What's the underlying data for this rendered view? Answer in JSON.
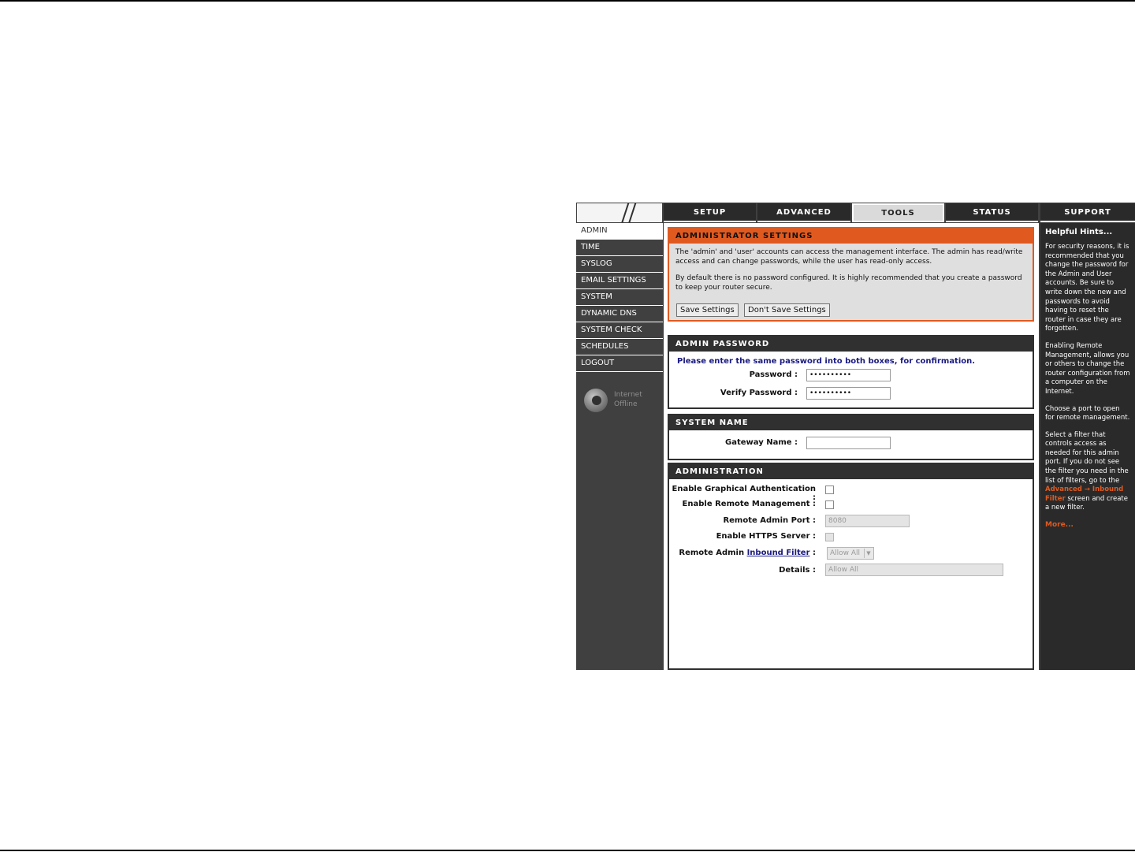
{
  "nav": {
    "tabs": [
      {
        "label": "SETUP"
      },
      {
        "label": "ADVANCED"
      },
      {
        "label": "TOOLS"
      },
      {
        "label": "STATUS"
      },
      {
        "label": "SUPPORT"
      }
    ]
  },
  "sidebar": {
    "items": [
      {
        "label": "ADMIN"
      },
      {
        "label": "TIME"
      },
      {
        "label": "SYSLOG"
      },
      {
        "label": "EMAIL SETTINGS"
      },
      {
        "label": "SYSTEM"
      },
      {
        "label": "DYNAMIC DNS"
      },
      {
        "label": "SYSTEM CHECK"
      },
      {
        "label": "SCHEDULES"
      },
      {
        "label": "LOGOUT"
      }
    ],
    "internet_status": {
      "line1": "Internet",
      "line2": "Offline"
    }
  },
  "admin_settings": {
    "title": "ADMINISTRATOR SETTINGS",
    "desc1": "The 'admin' and 'user' accounts can access the management interface. The admin has read/write access and can change passwords, while the user has read-only access.",
    "desc2": "By default there is no password configured. It is highly recommended that you create a password to keep your router secure.",
    "save_label": "Save Settings",
    "dont_save_label": "Don't Save Settings"
  },
  "admin_password": {
    "title": "ADMIN PASSWORD",
    "instruction": "Please enter the same password into both boxes, for confirmation.",
    "password_label": "Password :",
    "password_value": "••••••••••",
    "verify_label": "Verify Password :",
    "verify_value": "••••••••••"
  },
  "system_name": {
    "title": "SYSTEM NAME",
    "gateway_label": "Gateway Name :",
    "gateway_value": ""
  },
  "administration": {
    "title": "ADMINISTRATION",
    "graphical_auth_label": "Enable Graphical Authentication :",
    "remote_mgmt_label": "Enable Remote Management :",
    "remote_port_label": "Remote Admin Port :",
    "remote_port_value": "8080",
    "https_label": "Enable HTTPS Server :",
    "inbound_prefix": "Remote Admin ",
    "inbound_link": "Inbound Filter",
    "inbound_suffix": " :",
    "inbound_value": "Allow All",
    "details_label": "Details :",
    "details_value": "Allow All"
  },
  "help": {
    "title": "Helpful Hints...",
    "hint1": "For security reasons, it is recommended that you change the password for the Admin and User accounts. Be sure to write down the new and passwords to avoid having to reset the router in case they are forgotten.",
    "hint2": "Enabling Remote Management, allows you or others to change the router configuration from a computer on the Internet.",
    "hint3": "Choose a port to open for remote management.",
    "hint4_pre": "Select a filter that controls access as needed for this admin port. If you do not see the filter you need in the list of filters, go to the ",
    "hint4_link": "Advanced → Inbound Filter",
    "hint4_post": " screen and create a new filter.",
    "more": "More..."
  },
  "colors": {
    "accent_orange": "#e05a20",
    "nav_dark": "#2a2a2a",
    "frame_gray": "#404040",
    "instruction_blue": "#1a1a80"
  }
}
